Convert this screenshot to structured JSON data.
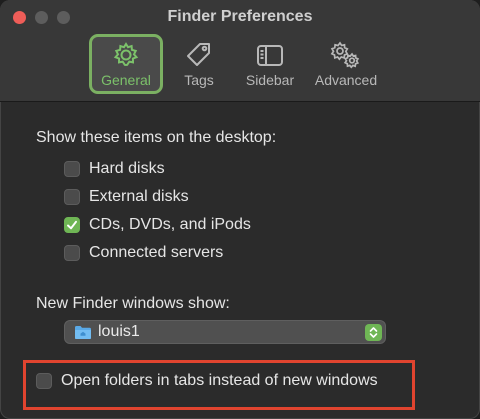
{
  "window": {
    "title": "Finder Preferences"
  },
  "toolbar": {
    "tabs": [
      {
        "label": "General",
        "icon": "gear-icon",
        "active": true
      },
      {
        "label": "Tags",
        "icon": "tag-icon",
        "active": false
      },
      {
        "label": "Sidebar",
        "icon": "sidebar-icon",
        "active": false
      },
      {
        "label": "Advanced",
        "icon": "gears-icon",
        "active": false
      }
    ]
  },
  "desktop_items": {
    "heading": "Show these items on the desktop:",
    "items": [
      {
        "label": "Hard disks",
        "checked": false
      },
      {
        "label": "External disks",
        "checked": false
      },
      {
        "label": "CDs, DVDs, and iPods",
        "checked": true
      },
      {
        "label": "Connected servers",
        "checked": false
      }
    ]
  },
  "new_window": {
    "heading": "New Finder windows show:",
    "selected": "louis1",
    "icon": "home-folder-icon"
  },
  "open_in_tabs": {
    "label": "Open folders in tabs instead of new windows",
    "checked": false
  },
  "colors": {
    "accent": "#6fb655",
    "highlight": "#e0442f"
  }
}
